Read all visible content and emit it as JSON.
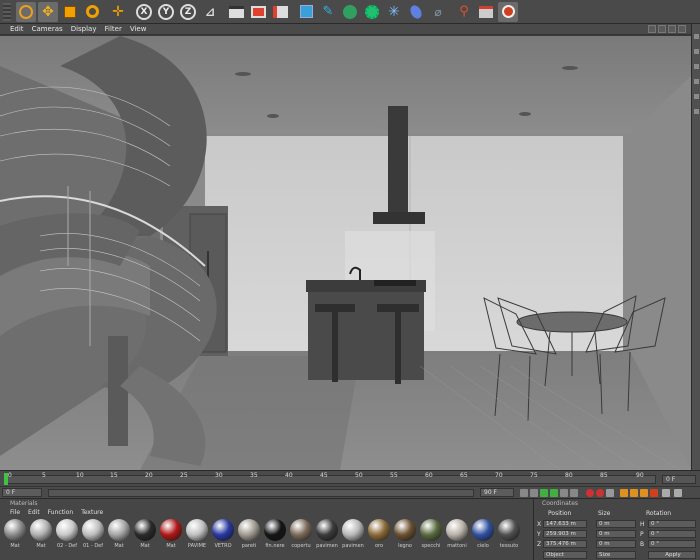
{
  "toolbar": {
    "tools": [
      {
        "icon": "undo-icon"
      },
      {
        "icon": "move-icon"
      },
      {
        "icon": "scale-icon"
      },
      {
        "icon": "rotate-icon"
      },
      {
        "icon": "live-selection-icon"
      }
    ],
    "axis_buttons": [
      {
        "icon": "x-axis-icon",
        "label": "X"
      },
      {
        "icon": "y-axis-icon",
        "label": "Y"
      },
      {
        "icon": "z-axis-icon",
        "label": "Z"
      }
    ],
    "render_tools": [
      {
        "icon": "coordinate-system-icon"
      },
      {
        "icon": "render-view-icon"
      },
      {
        "icon": "render-picture-viewer-icon"
      },
      {
        "icon": "render-settings-icon"
      }
    ],
    "object_tools": [
      {
        "icon": "cube-icon"
      },
      {
        "icon": "spline-pen-icon"
      },
      {
        "icon": "subdivision-icon"
      },
      {
        "icon": "array-icon"
      },
      {
        "icon": "deformer-icon"
      },
      {
        "icon": "scene-icon"
      },
      {
        "icon": "camera-icon"
      },
      {
        "icon": "light-icon"
      },
      {
        "icon": "layer-icon"
      },
      {
        "icon": "record-icon"
      }
    ]
  },
  "menu": {
    "items": [
      "Edit",
      "Cameras",
      "Display",
      "Filter",
      "View"
    ]
  },
  "timeline": {
    "ticks": [
      "0",
      "5",
      "10",
      "15",
      "20",
      "25",
      "30",
      "35",
      "40",
      "45",
      "50",
      "55",
      "60",
      "65",
      "70",
      "75",
      "80",
      "85",
      "90"
    ],
    "end_label": "0 F"
  },
  "transport": {
    "current_frame": "0 F",
    "start_frame": "0 F",
    "end_frame": "90 F"
  },
  "materials": {
    "title": "Materials",
    "menu": [
      "File",
      "Edit",
      "Function",
      "Texture"
    ],
    "items": [
      {
        "name": "Mat",
        "color": "#8a8a8a"
      },
      {
        "name": "Mat",
        "color": "#b0b0b0"
      },
      {
        "name": "02 - Def",
        "color": "#c8c8c8"
      },
      {
        "name": "01 - Def",
        "color": "#bdbdbd"
      },
      {
        "name": "Mat",
        "color": "#a5a5a5"
      },
      {
        "name": "Mat",
        "color": "#2a2a2a"
      },
      {
        "name": "Mat",
        "color": "#b01818"
      },
      {
        "name": "PAVIME",
        "color": "#c0c0c0"
      },
      {
        "name": "VETRO",
        "color": "#2838a0"
      },
      {
        "name": "pareti",
        "color": "#a09a90"
      },
      {
        "name": "fin.nere",
        "color": "#151515"
      },
      {
        "name": "copertu",
        "color": "#7a6a58"
      },
      {
        "name": "pavimen",
        "color": "#3a3a3a"
      },
      {
        "name": "pavimen",
        "color": "#b8b8b8"
      },
      {
        "name": "oro",
        "color": "#8a6a38"
      },
      {
        "name": "legno",
        "color": "#6a5030"
      },
      {
        "name": "specchi",
        "color": "#5a6a40"
      },
      {
        "name": "mattoni",
        "color": "#b8b0a8"
      },
      {
        "name": "cielo",
        "color": "#3050a0"
      },
      {
        "name": "tessuto",
        "color": "#505050"
      }
    ]
  },
  "coordinates": {
    "title": "Coordinates",
    "headers": [
      "Position",
      "Size",
      "Rotation"
    ],
    "rows": [
      {
        "axis": "X",
        "position": "147.633 m",
        "size": "0 m",
        "rot_axis": "H",
        "rotation": "0 °"
      },
      {
        "axis": "Y",
        "position": "259.903 m",
        "size": "0 m",
        "rot_axis": "P",
        "rotation": "0 °"
      },
      {
        "axis": "Z",
        "position": "375.476 m",
        "size": "0 m",
        "rot_axis": "B",
        "rotation": "0 °"
      }
    ],
    "mode": "Object",
    "size_mode": "Size",
    "apply": "Apply"
  },
  "colors": {
    "accent": "#f0a000",
    "render": "#e04030",
    "play": "#40b040",
    "record": "#d03030"
  }
}
